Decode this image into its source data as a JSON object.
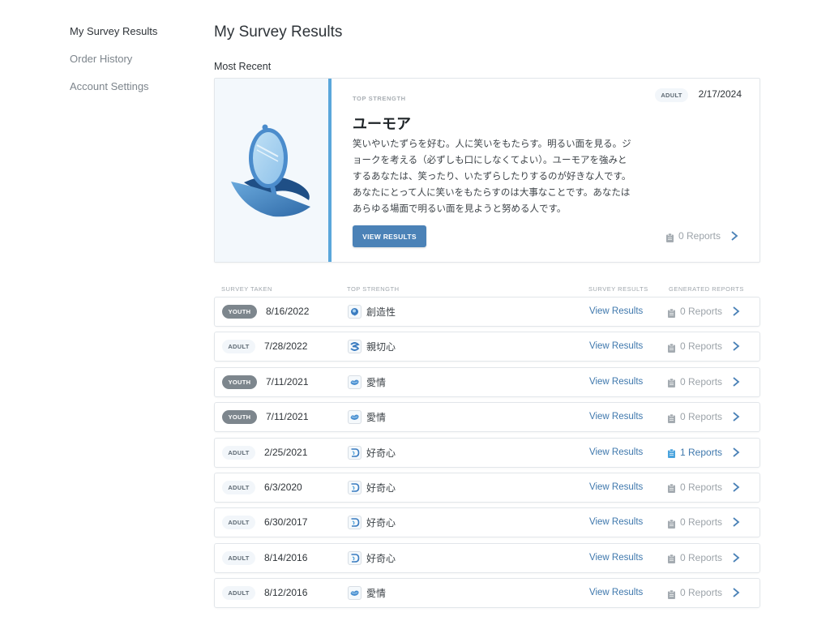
{
  "sidebar": {
    "items": [
      {
        "label": "My Survey Results",
        "active": true
      },
      {
        "label": "Order History",
        "active": false
      },
      {
        "label": "Account Settings",
        "active": false
      }
    ]
  },
  "page": {
    "title": "My Survey Results",
    "most_recent_label": "Most Recent"
  },
  "recent": {
    "top_strength_label": "TOP STRENGTH",
    "strength": "ユーモア",
    "illustration": "hand-mirror-illustration",
    "description": "笑いやいたずらを好む。人に笑いをもたらす。明るい面を見る。ジョークを考える（必ずしも口にしなくてよい）。ユーモアを強みとするあなたは、笑ったり、いたずらしたりするのが好きな人です。あなたにとって人に笑いをもたらすのは大事なことです。あなたはあらゆる場面で明るい面を見ようと努める人です。",
    "button_label": "VIEW RESULTS",
    "badge": "ADULT",
    "date": "2/17/2024",
    "reports": "0 Reports",
    "accent_color": "#5aa7db"
  },
  "table": {
    "headers": {
      "survey_taken": "SURVEY TAKEN",
      "top_strength": "TOP STRENGTH",
      "survey_results": "SURVEY RESULTS",
      "generated_reports": "GENERATED REPORTS"
    },
    "rows": [
      {
        "badge": "YOUTH",
        "type": "youth",
        "date": "8/16/2022",
        "strength": "創造性",
        "icon": "creativity-icon",
        "view": "View Results",
        "reports": "0 Reports",
        "has_reports": false
      },
      {
        "badge": "ADULT",
        "type": "adult",
        "date": "7/28/2022",
        "strength": "親切心",
        "icon": "kindness-icon",
        "view": "View Results",
        "reports": "0 Reports",
        "has_reports": false
      },
      {
        "badge": "YOUTH",
        "type": "youth",
        "date": "7/11/2021",
        "strength": "愛情",
        "icon": "love-icon",
        "view": "View Results",
        "reports": "0 Reports",
        "has_reports": false
      },
      {
        "badge": "YOUTH",
        "type": "youth",
        "date": "7/11/2021",
        "strength": "愛情",
        "icon": "love-icon",
        "view": "View Results",
        "reports": "0 Reports",
        "has_reports": false
      },
      {
        "badge": "ADULT",
        "type": "adult",
        "date": "2/25/2021",
        "strength": "好奇心",
        "icon": "curiosity-icon",
        "view": "View Results",
        "reports": "1 Reports",
        "has_reports": true
      },
      {
        "badge": "ADULT",
        "type": "adult",
        "date": "6/3/2020",
        "strength": "好奇心",
        "icon": "curiosity-icon",
        "view": "View Results",
        "reports": "0 Reports",
        "has_reports": false
      },
      {
        "badge": "ADULT",
        "type": "adult",
        "date": "6/30/2017",
        "strength": "好奇心",
        "icon": "curiosity-icon",
        "view": "View Results",
        "reports": "0 Reports",
        "has_reports": false
      },
      {
        "badge": "ADULT",
        "type": "adult",
        "date": "8/14/2016",
        "strength": "好奇心",
        "icon": "curiosity-icon",
        "view": "View Results",
        "reports": "0 Reports",
        "has_reports": false
      },
      {
        "badge": "ADULT",
        "type": "adult",
        "date": "8/12/2016",
        "strength": "愛情",
        "icon": "love-icon",
        "view": "View Results",
        "reports": "0 Reports",
        "has_reports": false
      }
    ]
  },
  "colors": {
    "link": "#3f78ad",
    "button": "#4b82b7",
    "reports_inactive": "#9ca3a9",
    "reports_active": "#3f78ad"
  }
}
